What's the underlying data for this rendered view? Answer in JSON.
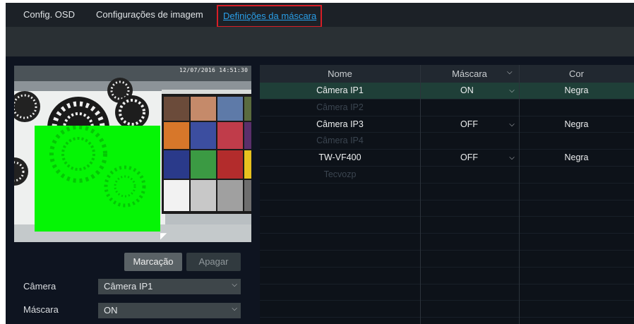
{
  "tabs": [
    {
      "label": "Config. OSD",
      "active": false
    },
    {
      "label": "Configurações de imagem",
      "active": false
    },
    {
      "label": "Definições da máscara",
      "active": true
    }
  ],
  "preview": {
    "timestamp": "12/07/2016 14:51:30"
  },
  "buttons": {
    "mark": "Marcação",
    "clear": "Apagar"
  },
  "form": {
    "camera_label": "Câmera",
    "camera_value": "Câmera IP1",
    "mask_label": "Máscara",
    "mask_value": "ON"
  },
  "table": {
    "columns": [
      "Nome",
      "Máscara",
      "Cor"
    ],
    "rows": [
      {
        "name": "Câmera IP1",
        "mask": "ON",
        "color": "Negra",
        "enabled": true,
        "selected": true
      },
      {
        "name": "Câmera IP2",
        "mask": "",
        "color": "",
        "enabled": false,
        "selected": false
      },
      {
        "name": "Câmera IP3",
        "mask": "OFF",
        "color": "Negra",
        "enabled": true,
        "selected": false
      },
      {
        "name": "Câmera IP4",
        "mask": "",
        "color": "",
        "enabled": false,
        "selected": false
      },
      {
        "name": "TW-VF400",
        "mask": "OFF",
        "color": "Negra",
        "enabled": true,
        "selected": false
      },
      {
        "name": "Tecvozp",
        "mask": "",
        "color": "",
        "enabled": false,
        "selected": false
      }
    ]
  },
  "colors": {
    "accent": "#2a9fe8",
    "highlight_border": "#d81e26",
    "mask_green": "#05f505",
    "selected_row": "#1f3f38"
  },
  "icons": {
    "dropdown": "chevron-down-icon",
    "cursor": "mouse-pointer-icon"
  }
}
